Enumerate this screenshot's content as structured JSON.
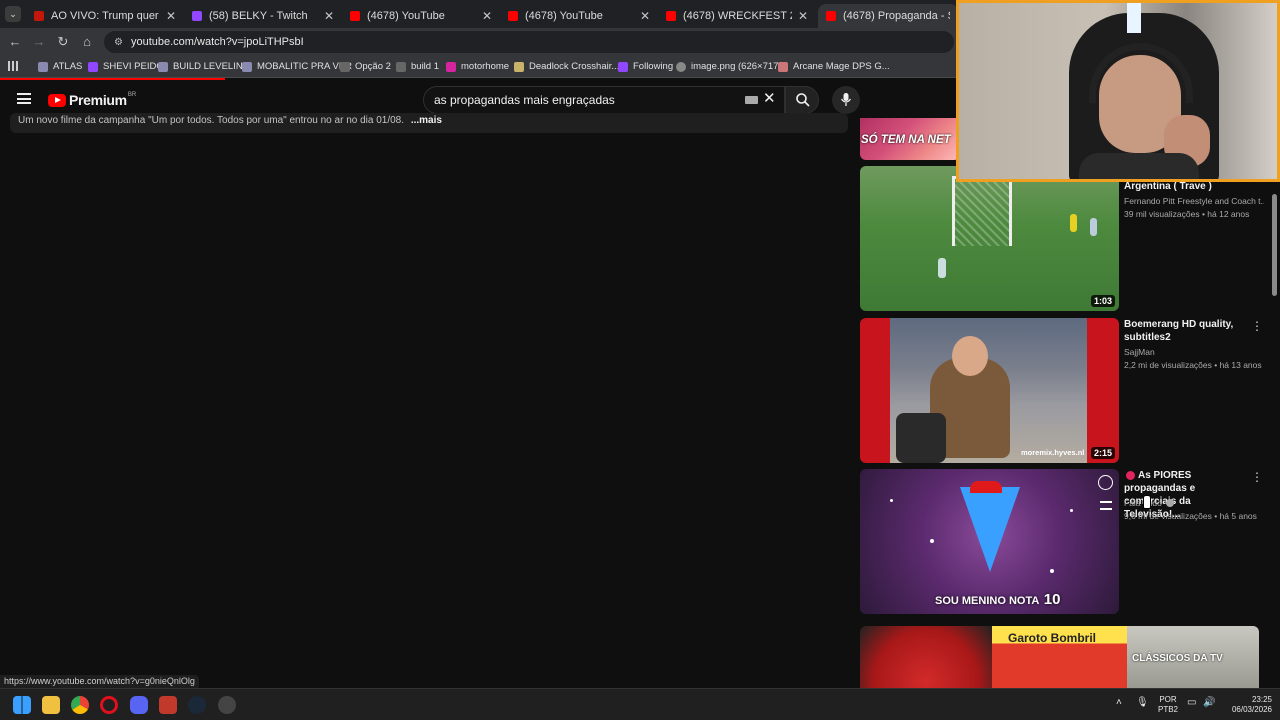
{
  "browser": {
    "tabs": [
      {
        "label": "AO VIVO: Trump quer 'rendição"
      },
      {
        "label": "(58) BELKY - Twitch"
      },
      {
        "label": "(4678) YouTube"
      },
      {
        "label": "(4678) YouTube"
      },
      {
        "label": "(4678) WRECKFEST 2 - Gamepla"
      },
      {
        "label": "(4678) Propaganda - Skol - Tub"
      }
    ],
    "url": "youtube.com/watch?v=jpoLiTHPsbI",
    "bookmarks": [
      {
        "label": "ATLAS"
      },
      {
        "label": "SHEVI PEIDO"
      },
      {
        "label": "BUILD LEVELING"
      },
      {
        "label": "MOBALITIC PRA VER"
      },
      {
        "label": "Opção 2"
      },
      {
        "label": "build 1"
      },
      {
        "label": "motorhome"
      },
      {
        "label": "Deadlock Crosshair..."
      },
      {
        "label": "Following"
      },
      {
        "label": "image.png (626×717)"
      },
      {
        "label": "Arcane Mage DPS G..."
      }
    ]
  },
  "youtube": {
    "logo_text": "Premium",
    "logo_region": "BR",
    "search_value": "as propagandas mais engraçadas",
    "description": "Um novo filme da campanha \"Um por todos. Todos por uma\" entrou no ar no dia 01/08.",
    "description_more": "...mais"
  },
  "sidebar": {
    "partial_thumb_text": "SÓ TEM NA NET",
    "videos": [
      {
        "title": "Argentina ( Trave )",
        "channel": "Fernando Pitt Freestyle and Coach t...",
        "meta": "39 mil visualizações • há 12 anos",
        "duration": "1:03"
      },
      {
        "title": "Boemerang HD quality, subtitles2",
        "channel": "SajjMan",
        "meta": "2,2 mi de visualizações • há 13 anos",
        "duration": "2:15",
        "thumb_text": "moremix.hyves.nl"
      },
      {
        "title": "As PIORES propagandas e comerciais da Televisão!...",
        "channel": "Fala Tudo",
        "meta": "9,6 mi de visualizações • há 5 anos",
        "thumb_text_main": "SOU MENINO NOTA",
        "thumb_text_num": "10"
      }
    ],
    "bottom_thumb_texts": [
      "Garoto Bombril",
      "CLÁSSICOS DA TV"
    ]
  },
  "status_link": "https://www.youtube.com/watch?v=g0nieQnlOlg",
  "taskbar": {
    "lang": "POR",
    "lang2": "PTB2",
    "time": "23:25",
    "date": "06/03/2026"
  },
  "colors": {
    "youtube_red": "#ff0000",
    "webcam_border": "#f0a020"
  }
}
